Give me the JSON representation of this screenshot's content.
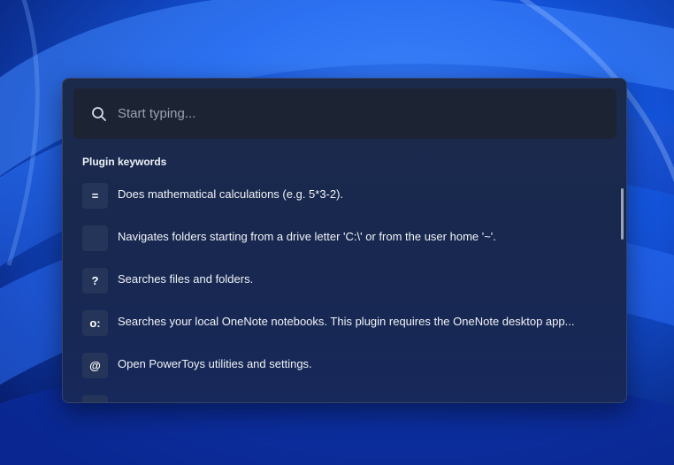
{
  "search": {
    "placeholder": "Start typing...",
    "value": ""
  },
  "section": {
    "title": "Plugin keywords"
  },
  "results": [
    {
      "keyword": "=",
      "description": "Does mathematical calculations (e.g. 5*3-2)."
    },
    {
      "keyword": "",
      "description": "Navigates folders starting from a drive letter 'C:\\' or from the user home '~'."
    },
    {
      "keyword": "?",
      "description": "Searches files and folders."
    },
    {
      "keyword": "o:",
      "description": "Searches your local OneNote notebooks. This plugin requires the OneNote desktop app..."
    },
    {
      "keyword": "@",
      "description": "Open PowerToys utilities and settings."
    },
    {
      "keyword": "",
      "description": ""
    }
  ],
  "theme": {
    "accent": "#0a3db8",
    "panel": "#182850",
    "search_bg": "#1c2333",
    "tile": "#253559"
  },
  "icons": {
    "search": "magnifier-icon"
  }
}
